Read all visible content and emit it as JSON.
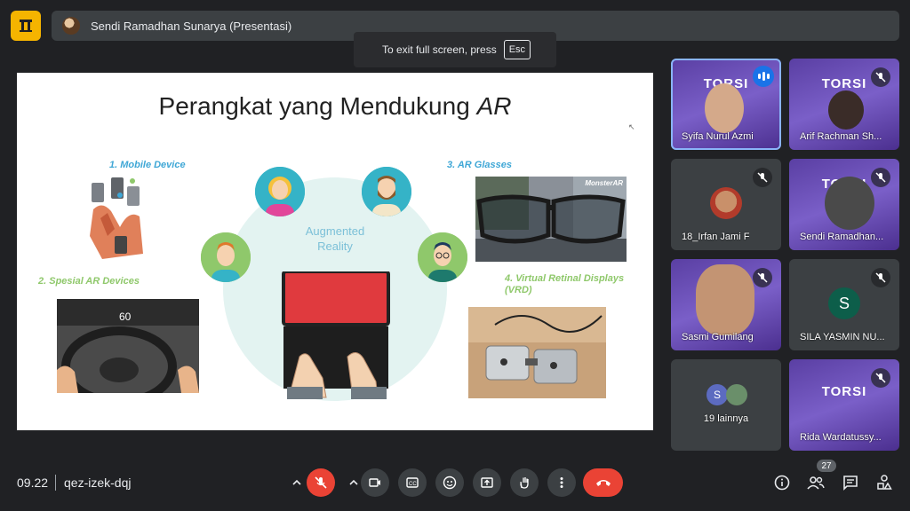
{
  "presenter_bar": {
    "name": "Sendi Ramadhan Sunarya (Presentasi)"
  },
  "fullscreen_toast": {
    "text": "To exit full screen, press",
    "key": "Esc"
  },
  "slide": {
    "title": "Perangkat yang Mendukung ",
    "title_italic": "AR",
    "center_text_line1": "Augmented",
    "center_text_line2": "Reality",
    "items": [
      "1. Mobile Device",
      "2. Spesial AR Devices",
      "3. AR Glasses",
      "4. Virtual Retinal Displays (VRD)"
    ],
    "glasses_brand": "MonsterAR",
    "speed_reading": "60"
  },
  "participants": [
    {
      "name": "Syifa Nurul Azmi",
      "torsi": "TORSI",
      "speaking": true
    },
    {
      "name": "Arif Rachman Sh...",
      "torsi": "TORSI",
      "muted": true
    },
    {
      "name": "18_Irfan Jami F",
      "muted": true
    },
    {
      "name": "Sendi Ramadhan...",
      "torsi": "TORSI",
      "muted": true
    },
    {
      "name": "Sasmi Gumilang",
      "muted": true
    },
    {
      "name": "SILA YASMIN NU...",
      "initial": "S",
      "muted": true
    },
    {
      "name": "19 lainnya",
      "initial": "S"
    },
    {
      "name": "Rida Wardatussy...",
      "torsi": "TORSI",
      "muted": true
    }
  ],
  "bottom": {
    "time": "09.22",
    "meeting_code": "qez-izek-dqj",
    "people_count": "27"
  },
  "colors": {
    "background": "#202124",
    "surface": "#3c4043",
    "danger": "#ea4335",
    "accent_yellow": "#f5b400",
    "speaking_blue": "#1a73e8"
  },
  "icons": [
    "home-logo-icon",
    "mic-off-icon",
    "camera-icon",
    "captions-icon",
    "emoji-icon",
    "present-icon",
    "raise-hand-icon",
    "more-options-icon",
    "end-call-icon",
    "info-icon",
    "people-icon",
    "chat-icon",
    "activities-icon"
  ]
}
